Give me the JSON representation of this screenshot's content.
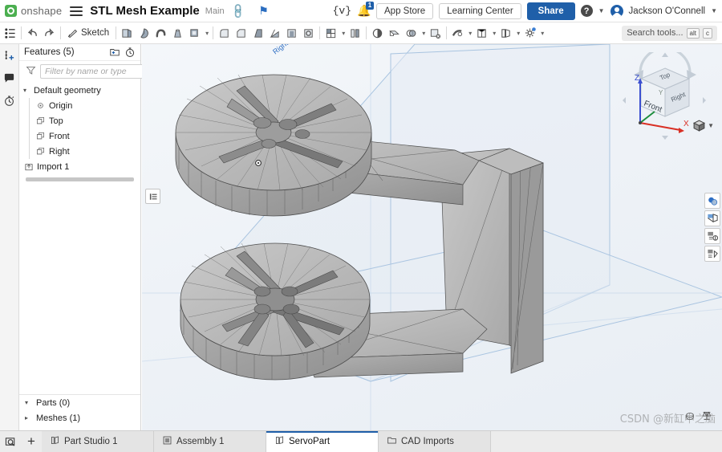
{
  "app": {
    "brand": "onshape",
    "document_title": "STL Mesh Example",
    "branch": "Main",
    "menu_icon": "hamburger-icon",
    "link_icon": "link-icon",
    "pin_icon": "pin-icon"
  },
  "topbar": {
    "variable_icon": "{v}",
    "notification_icon": "bell-icon",
    "notification_count": "1",
    "app_store_label": "App Store",
    "learning_center_label": "Learning Center",
    "share_label": "Share",
    "help_icon": "?",
    "user_name": "Jackson O'Connell",
    "accent_blue": "#1f5fa9"
  },
  "toolbar": {
    "feature_list_icon": "feature-list-icon",
    "undo_label": "←",
    "redo_label": "→",
    "sketch_label": "Sketch",
    "search_placeholder": "Search tools...",
    "shortcut_key_1": "alt",
    "shortcut_key_2": "c",
    "tools": [
      {
        "name": "extrude-tool",
        "glyph": "◰"
      },
      {
        "name": "revolve-tool",
        "glyph": "◔"
      },
      {
        "name": "sweep-tool",
        "glyph": "⤳"
      },
      {
        "name": "loft-tool",
        "glyph": "△"
      },
      {
        "name": "thicken-tool",
        "glyph": "⬛"
      },
      {
        "name": "fillet-tool",
        "glyph": "◠"
      },
      {
        "name": "chamfer-tool",
        "glyph": "◢"
      },
      {
        "name": "draft-tool",
        "glyph": "◥"
      },
      {
        "name": "rib-tool",
        "glyph": "◤"
      },
      {
        "name": "shell-tool",
        "glyph": "▣"
      },
      {
        "name": "hole-tool",
        "glyph": "◎"
      },
      {
        "name": "pattern-tool",
        "glyph": "⊞"
      },
      {
        "name": "mirror-tool",
        "glyph": "◫"
      },
      {
        "name": "transform-tool",
        "glyph": "◑"
      },
      {
        "name": "split-tool",
        "glyph": "◱"
      },
      {
        "name": "boolean-tool",
        "glyph": "◕"
      },
      {
        "name": "delete-face-tool",
        "glyph": "▧"
      },
      {
        "name": "sheet-metal-tool",
        "glyph": "⧉"
      },
      {
        "name": "insert-part-tool",
        "glyph": "◳"
      },
      {
        "name": "assembly-tool",
        "glyph": "◲"
      },
      {
        "name": "settings-tool",
        "glyph": "⚙"
      }
    ]
  },
  "rail": {
    "items": [
      {
        "name": "insert-feature-icon",
        "label": "Insert feature"
      },
      {
        "name": "comment-icon",
        "label": "Comments"
      },
      {
        "name": "history-icon",
        "label": "History"
      }
    ]
  },
  "feature_panel": {
    "title": "Features (5)",
    "folder_icon": "new-folder-icon",
    "rollback_icon": "rollback-icon",
    "filter_icon": "funnel-icon",
    "filter_placeholder": "Filter by name or type",
    "filter_value": "",
    "tree": [
      {
        "name": "default-geometry",
        "label": "Default geometry",
        "icon": "chevron-down-icon",
        "level": 0,
        "expanded": true
      },
      {
        "name": "origin",
        "label": "Origin",
        "icon": "origin-icon",
        "level": 1
      },
      {
        "name": "plane-top",
        "label": "Top",
        "icon": "plane-icon",
        "level": 1
      },
      {
        "name": "plane-front",
        "label": "Front",
        "icon": "plane-icon",
        "level": 1
      },
      {
        "name": "plane-right",
        "label": "Right",
        "icon": "plane-icon",
        "level": 1
      },
      {
        "name": "import-1",
        "label": "Import 1",
        "icon": "import-icon",
        "level": 0
      }
    ],
    "footer": [
      {
        "name": "parts-section",
        "label": "Parts (0)",
        "chevron": "⌄",
        "expanded": true
      },
      {
        "name": "meshes-section",
        "label": "Meshes (1)",
        "chevron": "›",
        "expanded": false
      }
    ]
  },
  "viewport": {
    "plane_label_right": "Right",
    "flyout_icon": "panel-list-icon",
    "watermark": "CSDN @新缸中之脑",
    "viewcube": {
      "face_top": "Top",
      "face_front": "Front",
      "face_right": "Right",
      "axis_x": "X",
      "axis_y": "Y",
      "axis_z": "Z",
      "axis_x_color": "#d93025",
      "axis_y_color": "#1e8e3e",
      "axis_z_color": "#3b4fd0",
      "view_menu_icon": "cube-dropdown-icon"
    },
    "right_tools": [
      {
        "name": "appearance-panel-icon"
      },
      {
        "name": "display-state-icon"
      },
      {
        "name": "render-settings-icon"
      },
      {
        "name": "section-view-icon"
      }
    ],
    "bottom_icons": [
      {
        "name": "measure-icon"
      },
      {
        "name": "mass-properties-icon"
      }
    ]
  },
  "tabbar": {
    "search_icon": "tab-search-icon",
    "add_label": "+",
    "tabs": [
      {
        "name": "tab-part-studio-1",
        "label": "Part Studio 1",
        "icon": "part-studio-icon",
        "active": false
      },
      {
        "name": "tab-assembly-1",
        "label": "Assembly 1",
        "icon": "assembly-icon",
        "active": false
      },
      {
        "name": "tab-servopart",
        "label": "ServoPart",
        "icon": "part-studio-icon",
        "active": true
      },
      {
        "name": "tab-cad-imports",
        "label": "CAD Imports",
        "icon": "folder-icon",
        "active": false
      }
    ]
  }
}
